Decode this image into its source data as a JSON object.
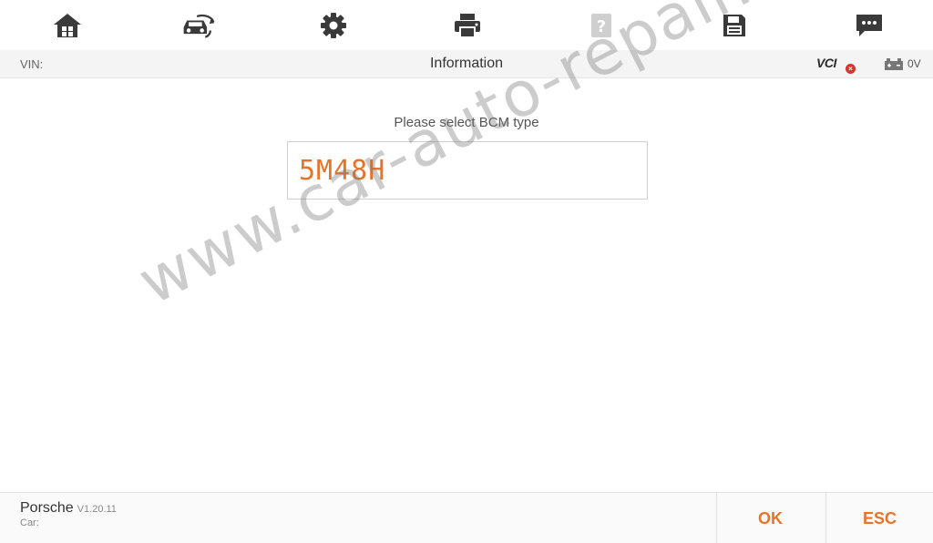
{
  "toolbar": {
    "icons": [
      "home-icon",
      "car-swap-icon",
      "settings-gear-icon",
      "printer-icon",
      "help-icon",
      "save-icon",
      "feedback-message-icon"
    ]
  },
  "infobar": {
    "vin_label": "VIN:",
    "title": "Information",
    "vci_label": "VCI",
    "voltage": "0V"
  },
  "main": {
    "prompt": "Please select BCM type",
    "options": [
      "5M48H"
    ]
  },
  "watermark": "www.car-auto-repair.com",
  "footer": {
    "brand": "Porsche",
    "version": "V1.20.11",
    "car_label": "Car:",
    "ok_label": "OK",
    "esc_label": "ESC"
  },
  "colors": {
    "accent": "#e8742a",
    "icon": "#3a3a3a",
    "icon_disabled": "#cfcfcf",
    "vci_error": "#e03030"
  }
}
